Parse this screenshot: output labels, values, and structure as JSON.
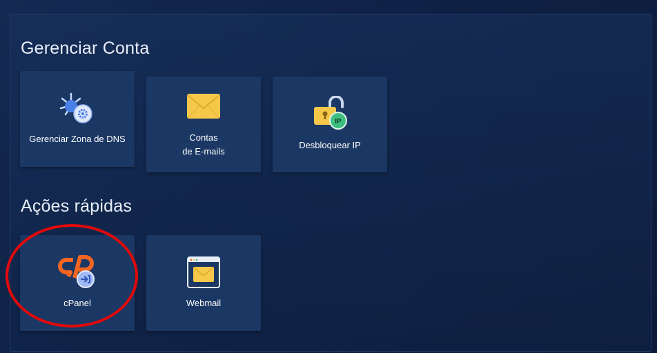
{
  "sections": {
    "manage": {
      "title": "Gerenciar Conta"
    },
    "quick": {
      "title": "Ações rápidas"
    }
  },
  "tiles": {
    "dns": {
      "label": "Gerenciar Zona de DNS",
      "icon": "dns-gear-icon"
    },
    "emails": {
      "label_line1": "Contas",
      "label_line2": "de E-mails",
      "icon": "envelope-icon"
    },
    "unblock_ip": {
      "label": "Desbloquear IP",
      "icon": "unlock-ip-icon"
    },
    "cpanel": {
      "label": "cPanel",
      "icon": "cpanel-login-icon"
    },
    "webmail": {
      "label": "Webmail",
      "icon": "webmail-window-icon"
    }
  },
  "colors": {
    "accent_orange": "#f26522",
    "envelope_yellow": "#f6c84a",
    "badge_blue": "#5b8def",
    "badge_green": "#3fbf7f",
    "highlight_red": "#e10a0a"
  }
}
